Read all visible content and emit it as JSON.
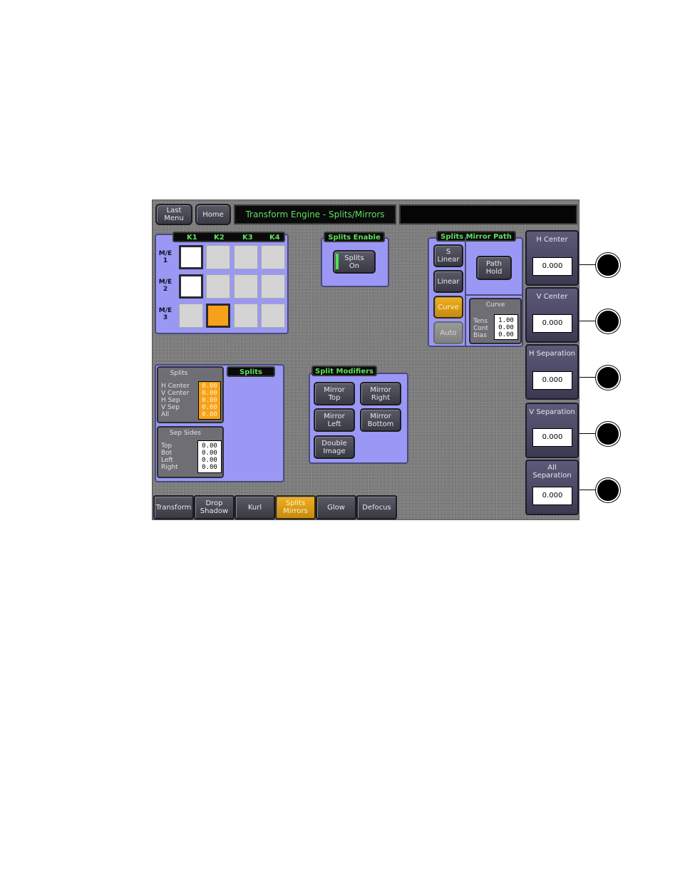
{
  "header": {
    "last_menu": "Last\nMenu",
    "home": "Home",
    "title": "Transform Engine - Splits/Mirrors",
    "status": ""
  },
  "keyer_grid": {
    "columns": [
      "K1",
      "K2",
      "K3",
      "K4"
    ],
    "rows": [
      "M/E\n1",
      "M/E\n2",
      "M/E\n3"
    ]
  },
  "splits_enable": {
    "title": "Splits Enable",
    "button": "Splits\nOn"
  },
  "splits_mirror_path": {
    "title": "Splits Mirror Path",
    "s_linear": "S\nLinear",
    "linear": "Linear",
    "curve": "Curve",
    "auto": "Auto",
    "path_hold": "Path\nHold",
    "curve_box": {
      "title": "Curve",
      "labels": [
        "Tens",
        "Cont",
        "Bias"
      ],
      "values": [
        "1.00",
        "0.00",
        "0.00"
      ]
    }
  },
  "splits_panel": {
    "tag": "Splits",
    "box_title": "Splits",
    "labels": [
      "H Center",
      "V Center",
      "H Sep",
      "V Sep",
      "All"
    ],
    "values": [
      "0.00",
      "0.00",
      "0.00",
      "0.00",
      "0.00"
    ],
    "sep_title": "Sep Sides",
    "sep_labels": [
      "Top",
      "Bot",
      "Left",
      "Right"
    ],
    "sep_values": [
      "0.00",
      "0.00",
      "0.00",
      "0.00"
    ]
  },
  "split_modifiers": {
    "title": "Split Modifiers",
    "mirror_top": "Mirror\nTop",
    "mirror_right": "Mirror\nRight",
    "mirror_left": "Mirror\nLeft",
    "mirror_bottom": "Mirror\nBottom",
    "double_image": "Double\nImage"
  },
  "side_controls": [
    {
      "label": "H Center",
      "value": "0.000"
    },
    {
      "label": "V Center",
      "value": "0.000"
    },
    {
      "label": "H Separation",
      "value": "0.000"
    },
    {
      "label": "V Separation",
      "value": "0.000"
    },
    {
      "label": "All\nSeparation",
      "value": "0.000"
    }
  ],
  "tabs": {
    "transform": "Transform",
    "drop_shadow": "Drop\nShadow",
    "kurl": "Kurl",
    "splits_mirrors": "Splits\nMirrors",
    "glow": "Glow",
    "defocus": "Defocus"
  },
  "colors": {
    "panel": "#9a98f4",
    "accent_orange": "#f7a11a",
    "tag_text": "#5fe05f",
    "title_text": "#5fe05f"
  }
}
